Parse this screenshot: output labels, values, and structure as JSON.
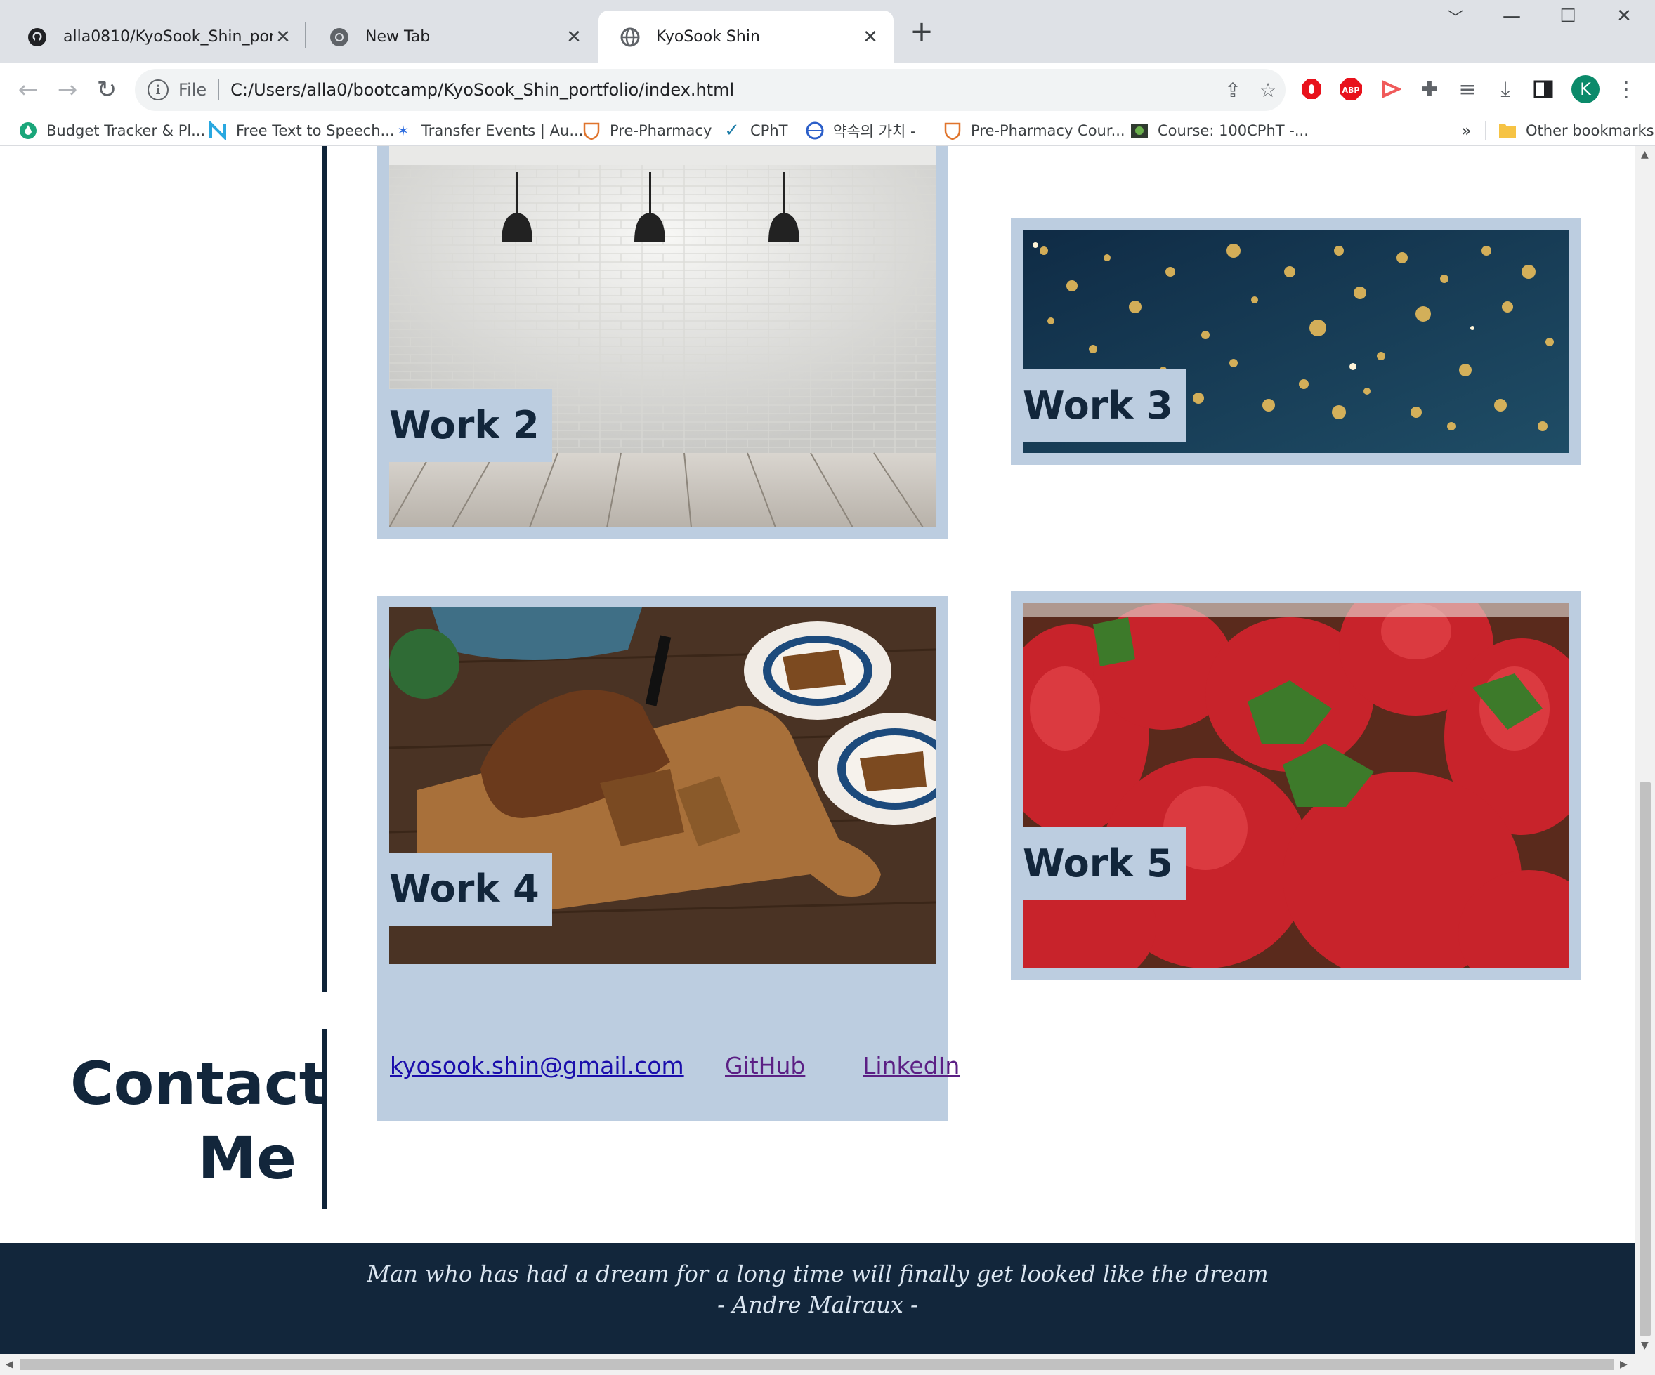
{
  "browser": {
    "tabs": [
      {
        "title": "alla0810/KyoSook_Shin_portfolio",
        "icon": "github-icon",
        "active": false
      },
      {
        "title": "New Tab",
        "icon": "chrome-icon",
        "active": false
      },
      {
        "title": "KyoSook Shin",
        "icon": "globe-icon",
        "active": true
      }
    ],
    "omnibox": {
      "scheme_label": "File",
      "url": "C:/Users/alla0/bootcamp/KyoSook_Shin_portfolio/index.html"
    },
    "profile_initial": "K",
    "bookmarks": [
      {
        "label": "Budget Tracker & Pl...",
        "icon": "drop-icon"
      },
      {
        "label": "Free Text to Speech...",
        "icon": "n-logo-icon"
      },
      {
        "label": "Transfer Events | Au...",
        "icon": "star-burst-icon"
      },
      {
        "label": "Pre-Pharmacy",
        "icon": "shield-icon"
      },
      {
        "label": "CPhT",
        "icon": "checkmark-icon"
      },
      {
        "label": "약속의 가치 -",
        "icon": "globe-badge-icon"
      },
      {
        "label": "Pre-Pharmacy Cour...",
        "icon": "shield-icon"
      },
      {
        "label": "Course: 100CPhT -...",
        "icon": "course-icon"
      }
    ],
    "bookmarks_overflow": "»",
    "other_bookmarks": "Other bookmarks"
  },
  "works": [
    {
      "label": "Work 2"
    },
    {
      "label": "Work 3"
    },
    {
      "label": "Work 4"
    },
    {
      "label": "Work 5"
    }
  ],
  "contact": {
    "title_line1": "Contact",
    "title_line2": "Me",
    "links": [
      {
        "label": "kyosook.shin@gmail.com"
      },
      {
        "label": "GitHub"
      },
      {
        "label": "LinkedIn"
      }
    ]
  },
  "footer": {
    "quote": "Man who has had a dream for a long time will finally get looked like the dream",
    "author": "- Andre Malraux -"
  },
  "colors": {
    "navy": "#12263b",
    "card_frame": "#bccde0",
    "link": "#1a0dab",
    "link_visited": "#5b1f84"
  }
}
